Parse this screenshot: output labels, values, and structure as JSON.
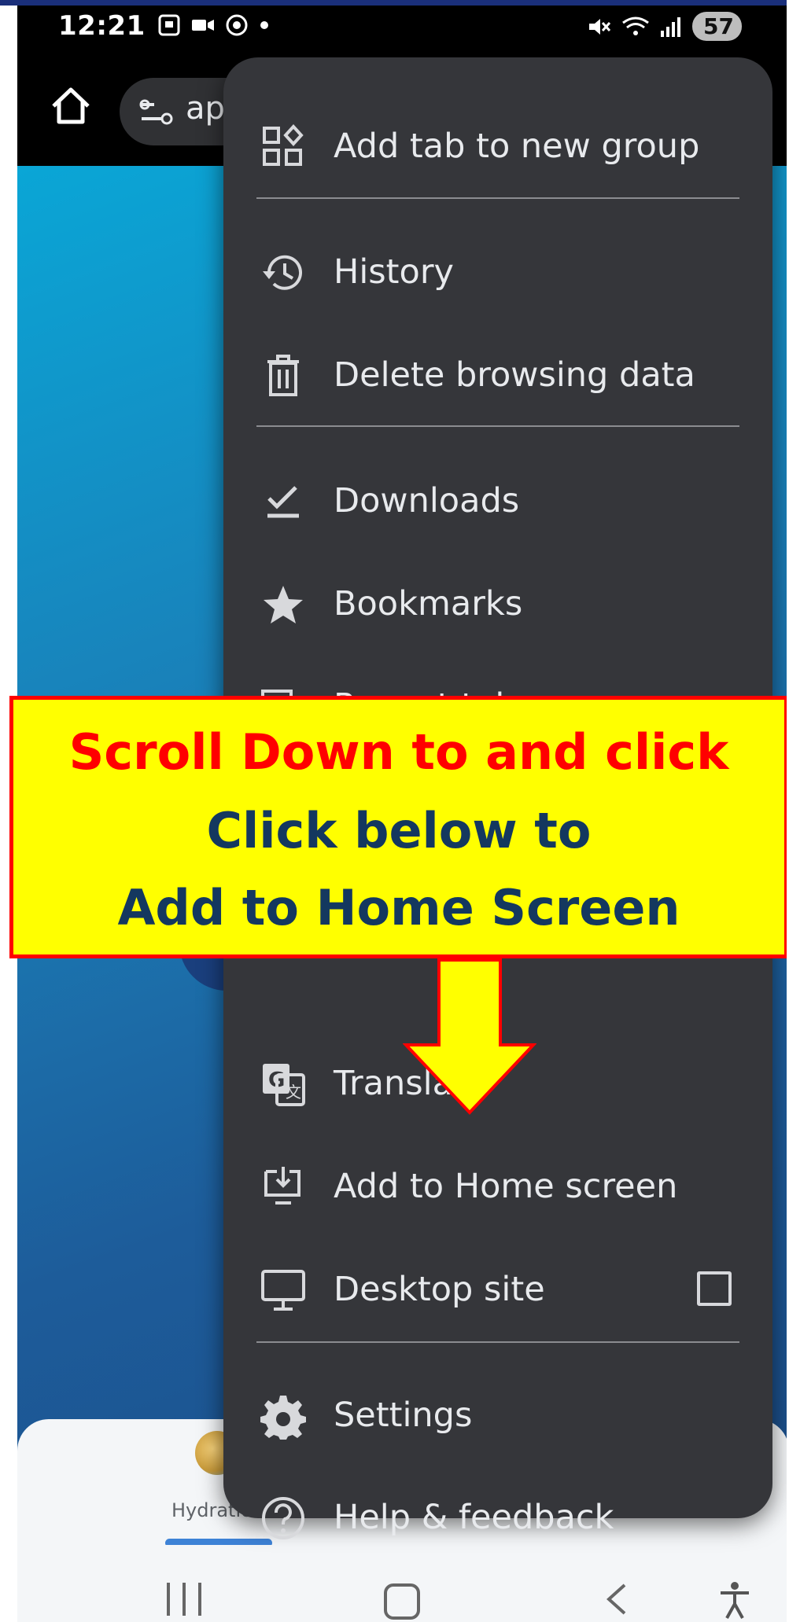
{
  "status_bar": {
    "time": "12:21",
    "battery": "57"
  },
  "toolbar": {
    "url_text": "ap"
  },
  "menu": {
    "items": [
      {
        "label": "Add tab to new group",
        "icon": "add-tab-group-icon"
      },
      {
        "label": "History",
        "icon": "history-icon"
      },
      {
        "label": "Delete browsing data",
        "icon": "trash-icon"
      },
      {
        "label": "Downloads",
        "icon": "download-check-icon"
      },
      {
        "label": "Bookmarks",
        "icon": "star-icon"
      },
      {
        "label": "Recent tabs",
        "icon": "recent-tabs-icon"
      },
      {
        "label": "Translate",
        "icon": "translate-icon"
      },
      {
        "label": "Add to Home screen",
        "icon": "add-to-home-icon"
      },
      {
        "label": "Desktop site",
        "icon": "desktop-icon",
        "checked": false
      },
      {
        "label": "Settings",
        "icon": "gear-icon"
      },
      {
        "label": "Help & feedback",
        "icon": "help-icon"
      }
    ]
  },
  "callout": {
    "line1": "Scroll Down to and click",
    "line2": "Click below to",
    "line3": "Add to Home Screen"
  },
  "bottom_nav": {
    "hydration_label": "Hydration"
  },
  "colors": {
    "menu_bg": "#35363a",
    "callout_bg": "#ffff00",
    "callout_border": "#ff0000",
    "callout_line1": "#ff0000",
    "callout_line2": "#14385f"
  }
}
